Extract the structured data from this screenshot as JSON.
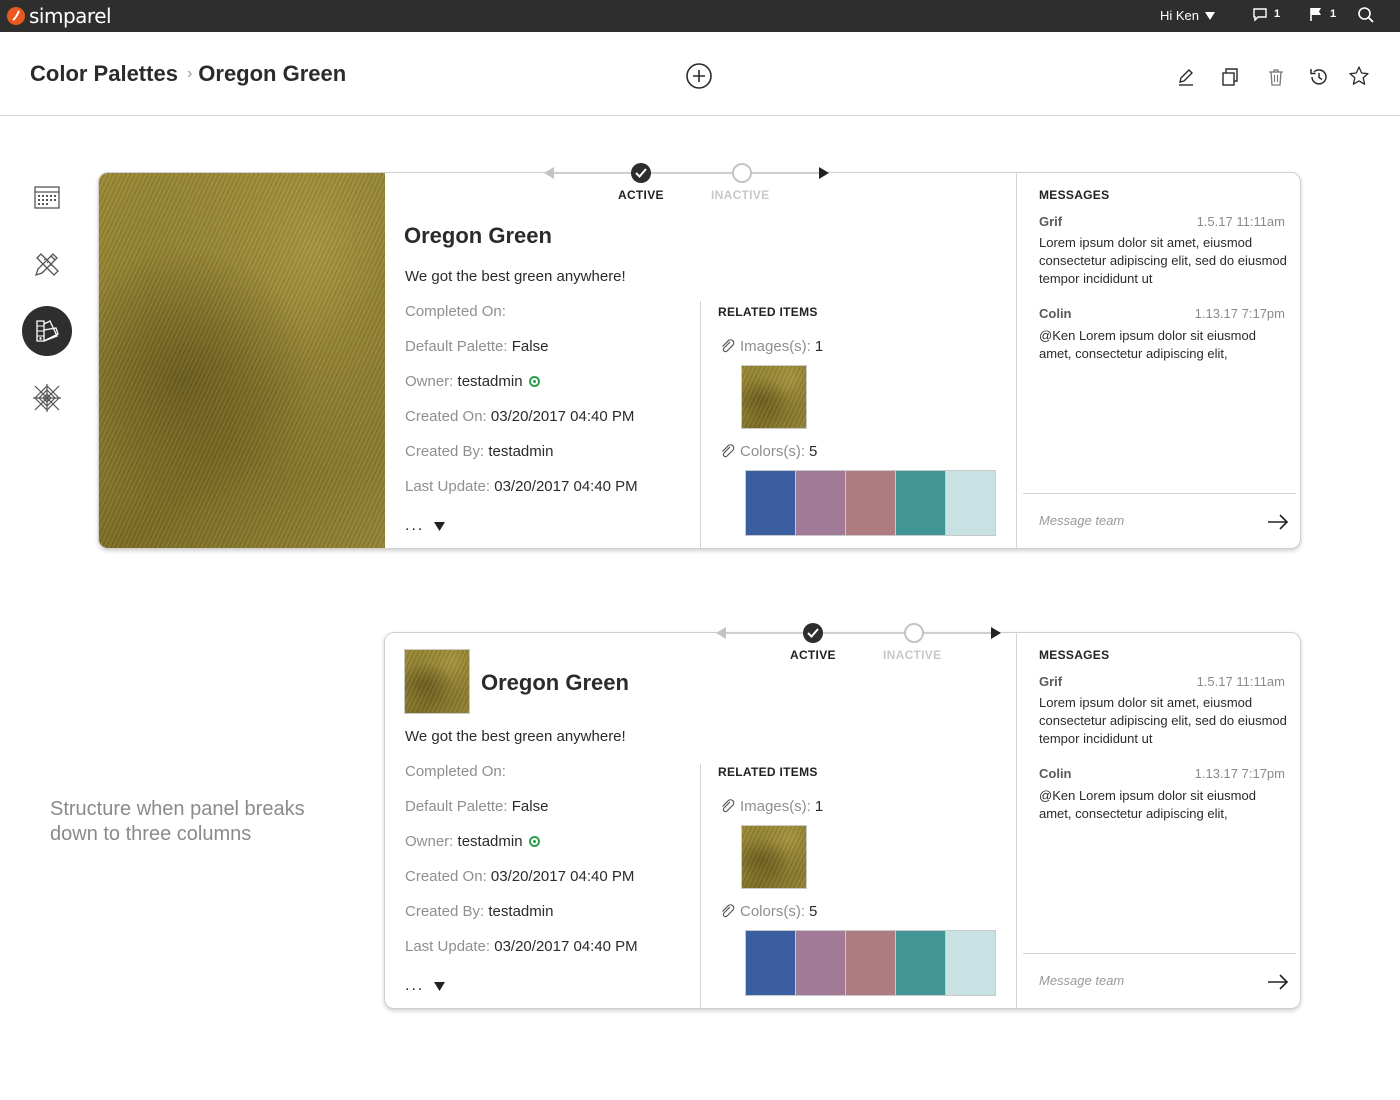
{
  "app": {
    "logo_text": "simparel",
    "brand_color": "#e8581f"
  },
  "topbar": {
    "greeting": "Hi Ken",
    "comments_count": "1",
    "flags_count": "1",
    "icons": [
      "chevron-down-icon",
      "comment-icon",
      "flag-icon",
      "search-icon"
    ]
  },
  "breadcrumb": {
    "parent": "Color Palettes",
    "separator": "›",
    "current": "Oregon Green"
  },
  "header_actions": [
    "add-icon",
    "edit-icon",
    "duplicate-icon",
    "trash-icon",
    "history-icon",
    "star-icon"
  ],
  "rail": [
    "calendar-icon",
    "design-tools-icon",
    "color-palette-icon",
    "pattern-icon"
  ],
  "status": {
    "active_label": "ACTIVE",
    "inactive_label": "INACTIVE"
  },
  "item": {
    "title": "Oregon Green",
    "description": "We got the best green anywhere!",
    "fields": [
      {
        "key": "Completed On:",
        "value": ""
      },
      {
        "key": "Default Palette:",
        "value": "False"
      },
      {
        "key": "Owner:",
        "value": "testadmin"
      },
      {
        "key": "Created On:",
        "value": "03/20/2017 04:40 PM"
      },
      {
        "key": "Created By:",
        "value": "testadmin"
      },
      {
        "key": "Last Update:",
        "value": "03/20/2017 04:40 PM"
      }
    ],
    "more": "...",
    "swatch_color": "#8f7f30"
  },
  "related": {
    "label": "RELATED ITEMS",
    "images_label": "Images(s):",
    "images_count": "1",
    "colors_label": "Colors(s):",
    "colors_count": "5",
    "colors": [
      "#3b5ea0",
      "#a17a98",
      "#ad7b80",
      "#429595",
      "#c8e2e4"
    ]
  },
  "messages": {
    "label": "MESSAGES",
    "list": [
      {
        "author": "Grif",
        "time": "1.5.17 11:11am",
        "text": "Lorem ipsum dolor sit amet, eiusmod consectetur adipiscing elit, sed do eiusmod tempor incididunt ut"
      },
      {
        "author": "Colin",
        "time": "1.13.17 7:17pm",
        "text": "@Ken Lorem ipsum dolor sit eiusmod amet, consectetur adipiscing elit,"
      }
    ],
    "placeholder": "Message team"
  },
  "note": "Structure when panel breaks down to three columns"
}
